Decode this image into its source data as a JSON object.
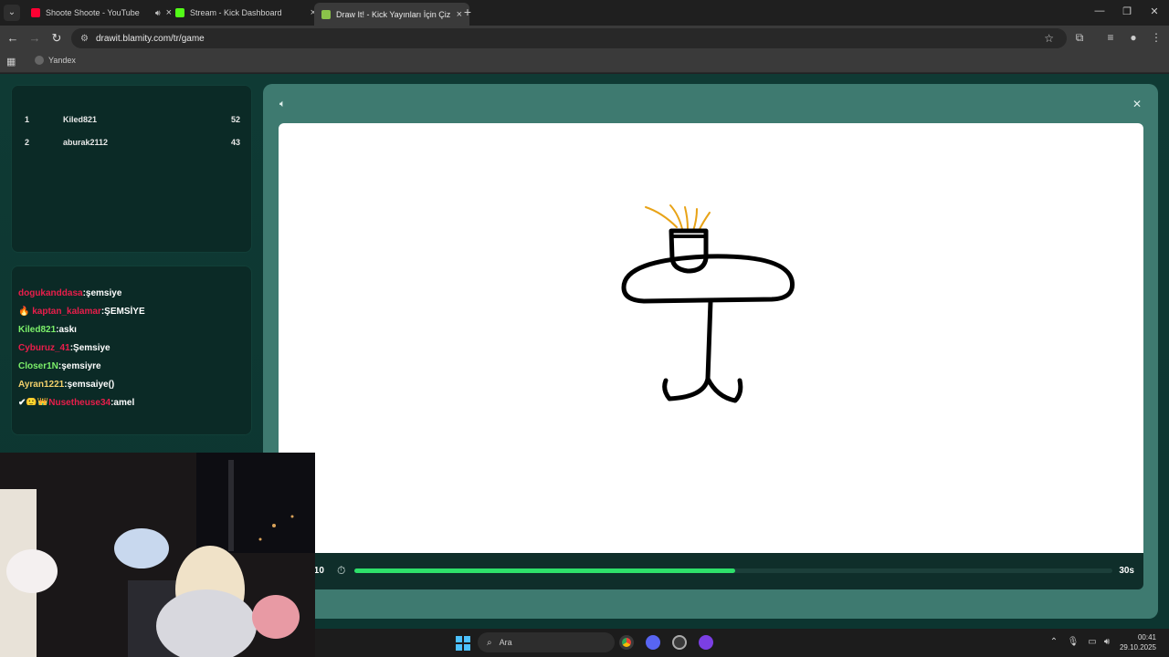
{
  "browser": {
    "tabs": [
      {
        "title": "Shoote Shoote - YouTube",
        "favicon_color": "#ff0033",
        "active": false
      },
      {
        "title": "Stream - Kick Dashboard",
        "favicon_color": "#53fc18",
        "active": false
      },
      {
        "title": "Draw It! - Kick Yayınları İçin Çiz...",
        "favicon_color": "#8bc34a",
        "active": true
      }
    ],
    "url": "drawit.blamity.com/tr/game",
    "bookmarks": [
      {
        "label": "Yandex"
      }
    ]
  },
  "leaderboard": {
    "rows": [
      {
        "rank": "1",
        "name": "Kiled821",
        "score": "52"
      },
      {
        "rank": "2",
        "name": "aburak2112",
        "score": "43"
      }
    ]
  },
  "chat": {
    "messages": [
      {
        "user": "dogukanddasa",
        "text": ":şemsiye",
        "color": "#e91e4b",
        "badge": ""
      },
      {
        "user": "kaptan_kalamar",
        "text": ":ŞEMSİYE",
        "color": "#e91e4b",
        "badge": "🔥"
      },
      {
        "user": "Kiled821",
        "text": ":askı",
        "color": "#7cf06a",
        "badge": ""
      },
      {
        "user": "Cyburuz_41",
        "text": ":Şemsiye",
        "color": "#e91e4b",
        "badge": ""
      },
      {
        "user": "Closer1N",
        "text": ":şemsiyre",
        "color": "#7cf06a",
        "badge": ""
      },
      {
        "user": "Ayran1221",
        "text": ":şemsaiye()",
        "color": "#f2d06b",
        "badge": ""
      },
      {
        "user": "Nusetheuse34",
        "text": ":amel",
        "color": "#e91e4b",
        "badge": "✔🙂👑"
      }
    ]
  },
  "game": {
    "round_label": "/10",
    "timer_progress": 0.503,
    "time_left": "30s"
  },
  "taskbar": {
    "search_label": "Ara",
    "time": "00:41",
    "date": "29.10.2025"
  }
}
